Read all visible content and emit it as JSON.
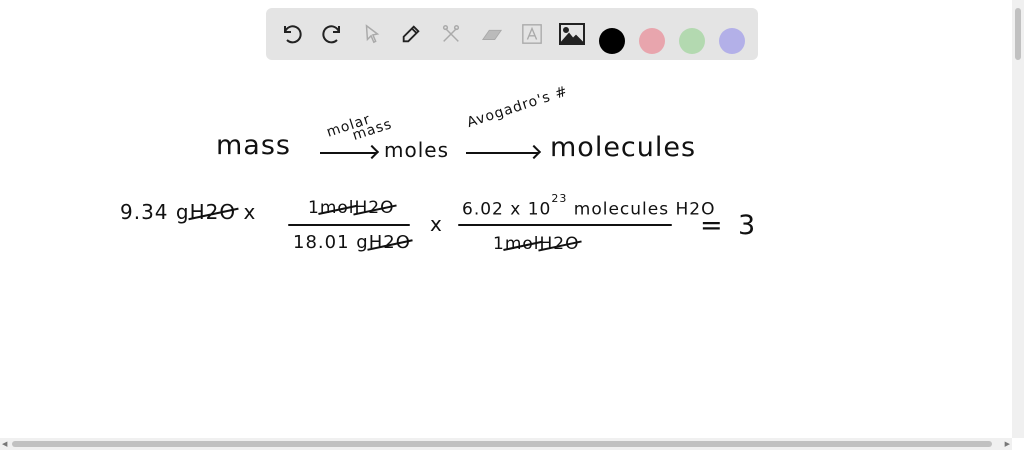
{
  "toolbar": {
    "tools": [
      "undo-icon",
      "redo-icon",
      "select-icon",
      "pen-icon",
      "tools-icon",
      "eraser-icon",
      "text-icon",
      "image-icon"
    ],
    "colors": {
      "black": "#000000",
      "red": "#e8a5ad",
      "green": "#b3d9b0",
      "purple": "#b3b0e8"
    }
  },
  "board": {
    "line1": {
      "mass": "mass",
      "arrow1_label_1": "molar",
      "arrow1_label_2": "mass",
      "moles": "moles",
      "arrow2_label": "Avogadro's #",
      "molecules": "molecules"
    },
    "line2": {
      "given_value": "9.34",
      "given_unit": "g",
      "given_sub": "H2O",
      "times1": "x",
      "f1_num_value": "1",
      "f1_num_unit": "mol",
      "f1_num_sub": "H2O",
      "f1_den_value": "18.01",
      "f1_den_unit": "g",
      "f1_den_sub": "H2O",
      "times2": "x",
      "f2_num_value": "6.02 x 10",
      "f2_num_exp": "23",
      "f2_num_unit": "molecules H2O",
      "f2_den_value": "1",
      "f2_den_unit": "mol",
      "f2_den_sub": "H2O",
      "equals": "=",
      "result": "3"
    }
  }
}
